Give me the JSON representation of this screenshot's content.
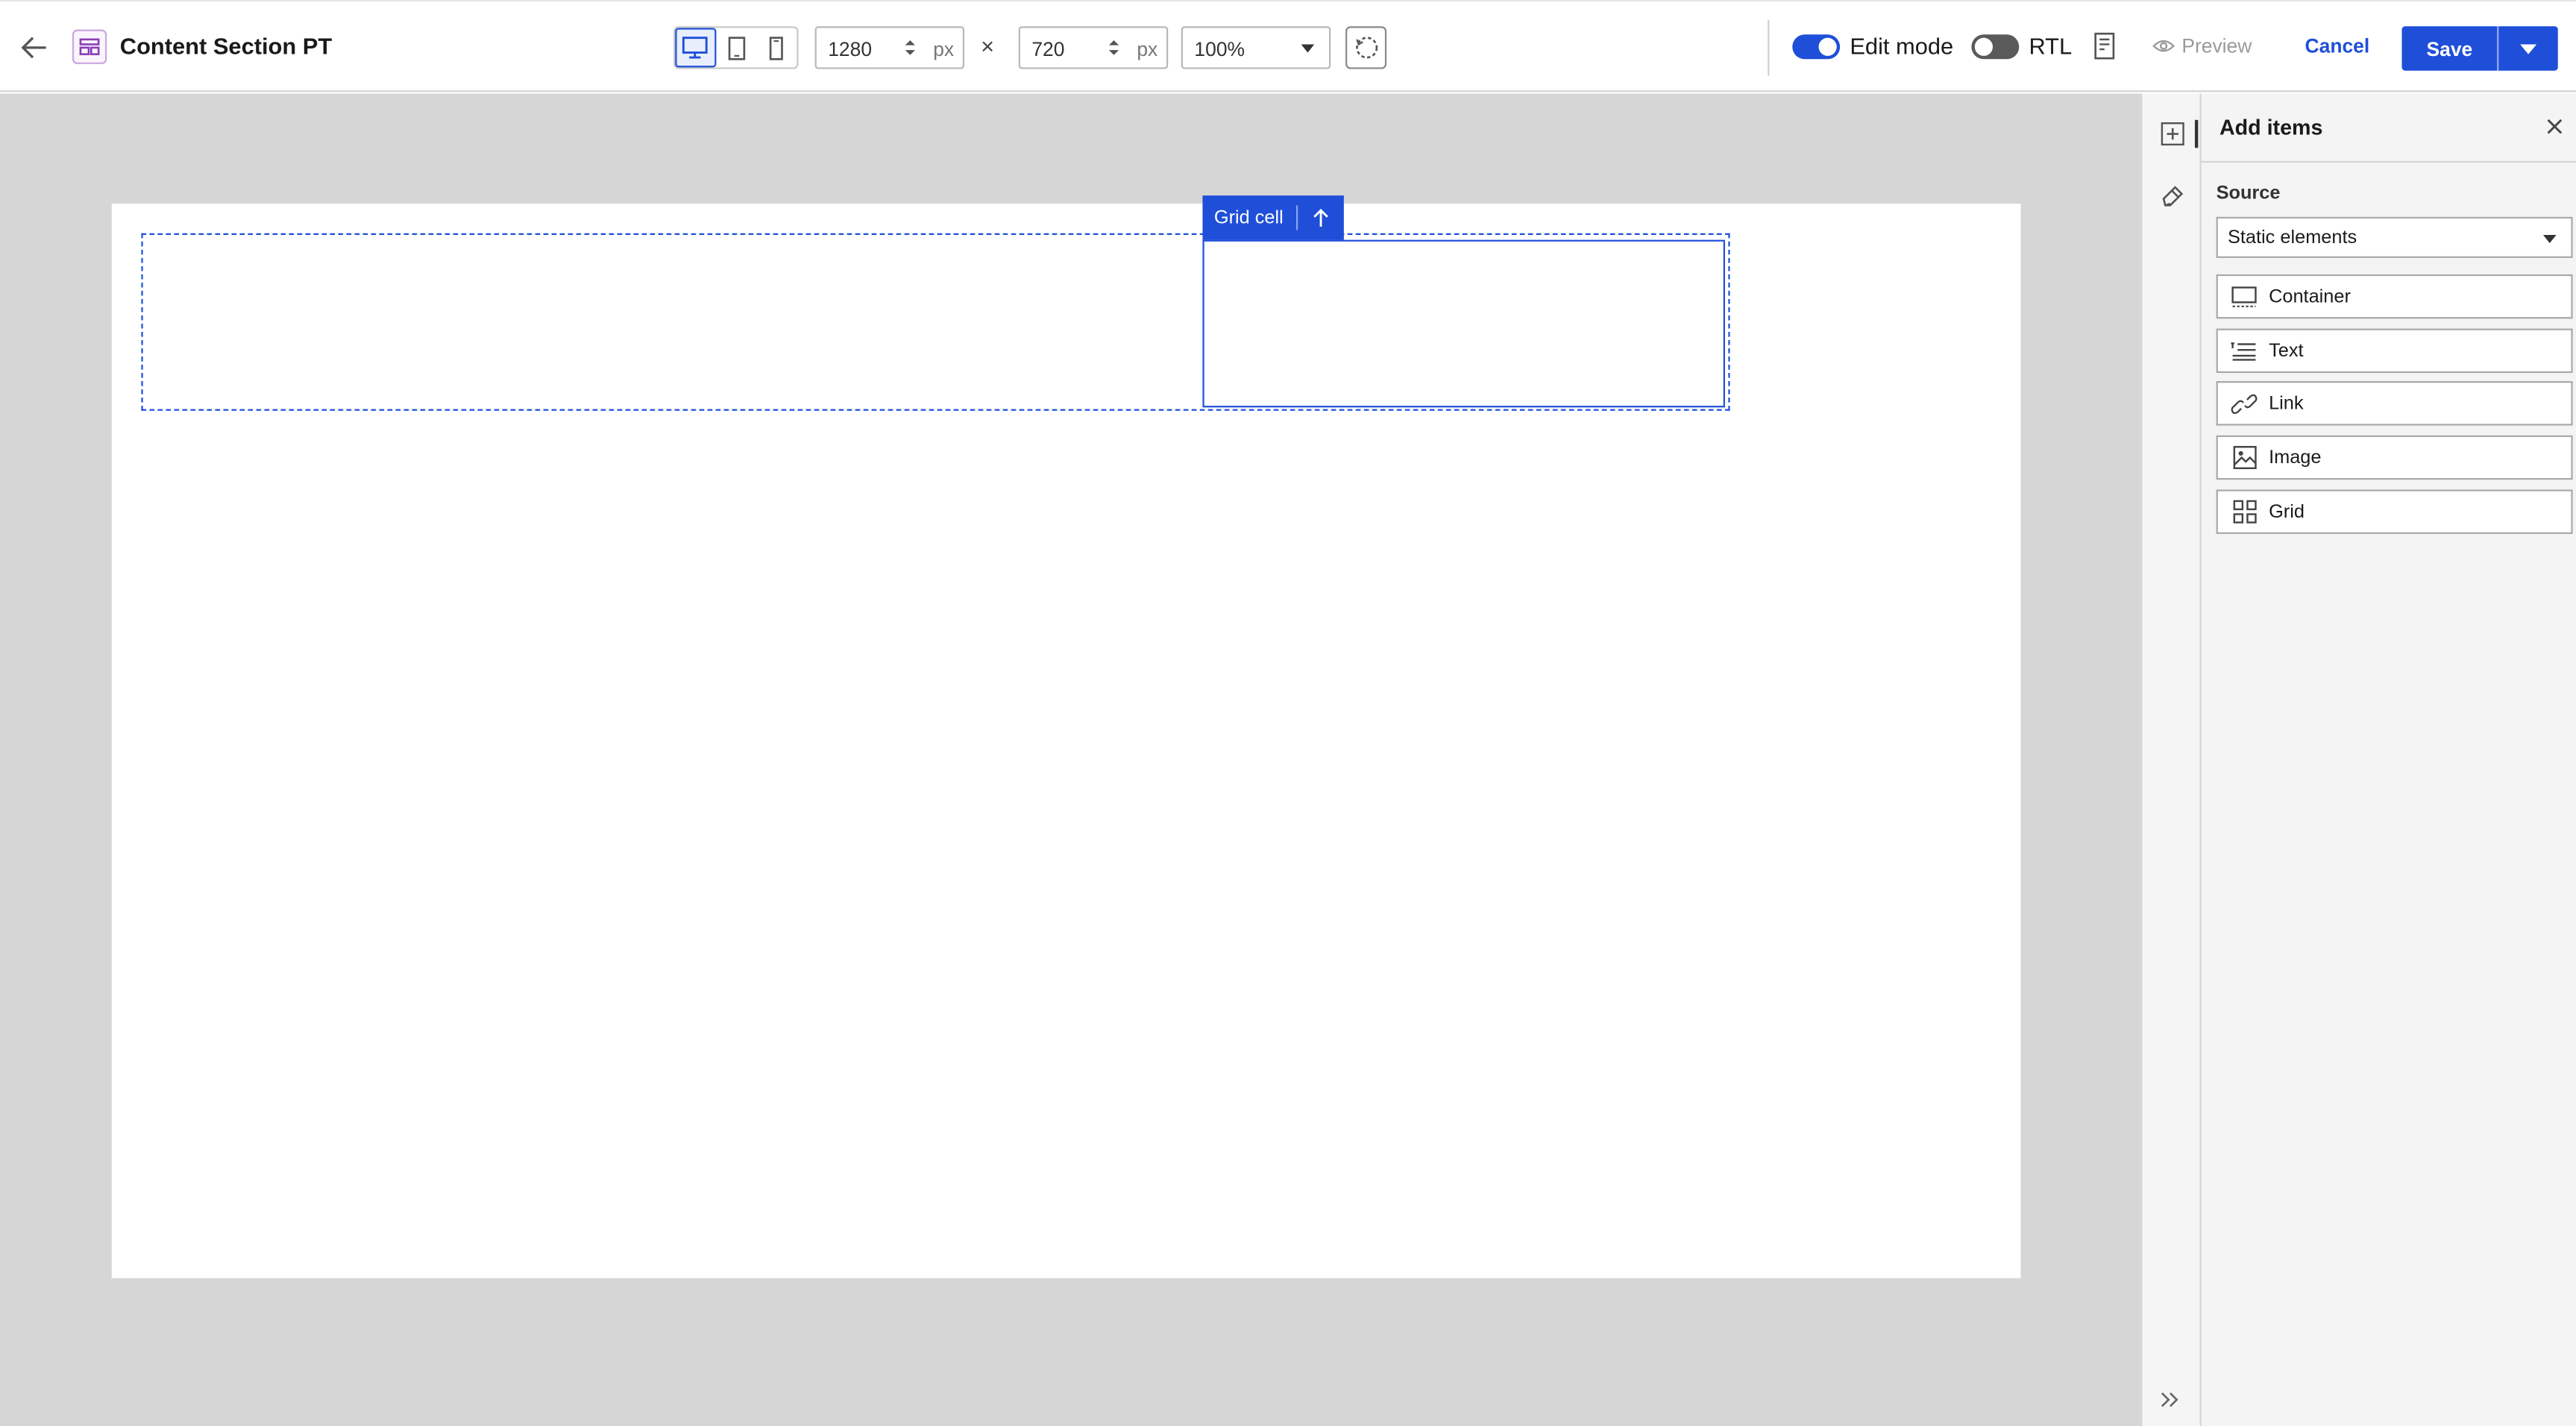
{
  "header": {
    "title": "Content Section PT",
    "width_value": "1280",
    "height_value": "720",
    "unit": "px",
    "times": "×",
    "zoom": "100%",
    "edit_mode_label": "Edit mode",
    "rtl_label": "RTL",
    "preview_label": "Preview",
    "cancel_label": "Cancel",
    "save_label": "Save"
  },
  "canvas": {
    "grid_cell_tag": "Grid cell"
  },
  "panel": {
    "title": "Add items",
    "source_label": "Source",
    "source_value": "Static elements",
    "items": [
      {
        "label": "Container",
        "icon": "container-icon"
      },
      {
        "label": "Text",
        "icon": "text-icon"
      },
      {
        "label": "Link",
        "icon": "link-icon"
      },
      {
        "label": "Image",
        "icon": "image-icon"
      },
      {
        "label": "Grid",
        "icon": "grid-icon"
      }
    ]
  },
  "colors": {
    "accent": "#1f4fd8",
    "canvas_bg": "#d6d6d6",
    "panel_bg": "#f4f4f4"
  }
}
